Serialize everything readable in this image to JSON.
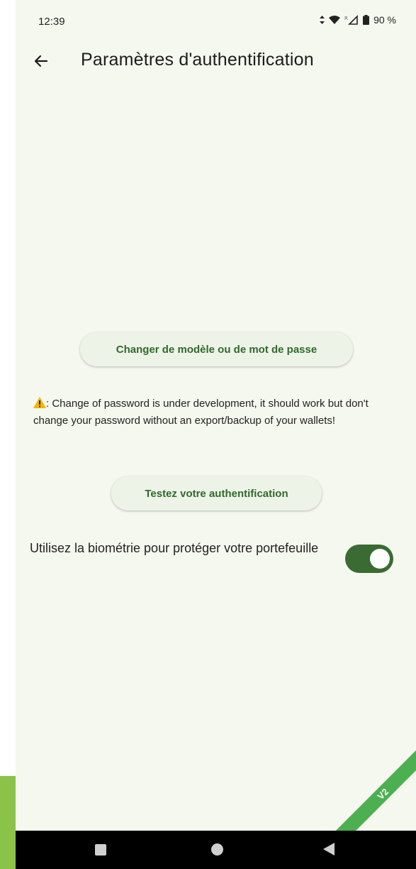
{
  "status_bar": {
    "time": "12:39",
    "battery_percent": "90 %"
  },
  "app_bar": {
    "title": "Paramètres d'authentification",
    "back_icon": "arrow-left-icon"
  },
  "buttons": {
    "change_model_label": "Changer de modèle ou de mot de passe",
    "test_auth_label": "Testez votre authentification"
  },
  "warning": {
    "icon": "warning-icon",
    "text": ": Change of password is under development, it should work but don't change your password without an export/backup of your wallets!"
  },
  "biometrics": {
    "label": "Utilisez la biométrie pour protéger votre portefeuille",
    "enabled": true
  },
  "ribbon": {
    "label": "V2"
  },
  "nav_bar": {
    "recents_icon": "square-icon",
    "home_icon": "circle-icon",
    "back_icon": "triangle-back-icon"
  },
  "colors": {
    "background": "#f4f8ef",
    "accent": "#3a6b32",
    "button_text": "#2f6a2a",
    "ribbon": "#4caf50",
    "left_strip": "#8bc34a"
  }
}
